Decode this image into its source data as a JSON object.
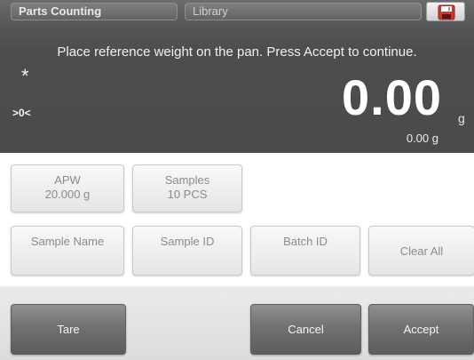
{
  "header": {
    "app_tab": "Parts Counting",
    "library_tab": "Library",
    "save_icon": "floppy-disk-icon"
  },
  "display": {
    "instruction": "Place reference weight on the pan.  Press Accept to continue.",
    "stable_indicator": "*",
    "center_zero_indicator": ">0<",
    "main_value": "0.00",
    "main_unit": "g",
    "secondary_value": "0.00 g"
  },
  "buttons": {
    "apw_label": "APW",
    "apw_value": "20.000 g",
    "samples_label": "Samples",
    "samples_value": "10 PCS",
    "sample_name": "Sample Name",
    "sample_id": "Sample ID",
    "batch_id": "Batch ID",
    "clear_all": "Clear All",
    "tare": "Tare",
    "cancel": "Cancel",
    "accept": "Accept"
  },
  "colors": {
    "display_bg": "#4b4c4e",
    "button_bg": "#efeff0",
    "dark_button_bg": "#707173",
    "save_icon_color": "#c8392f"
  }
}
